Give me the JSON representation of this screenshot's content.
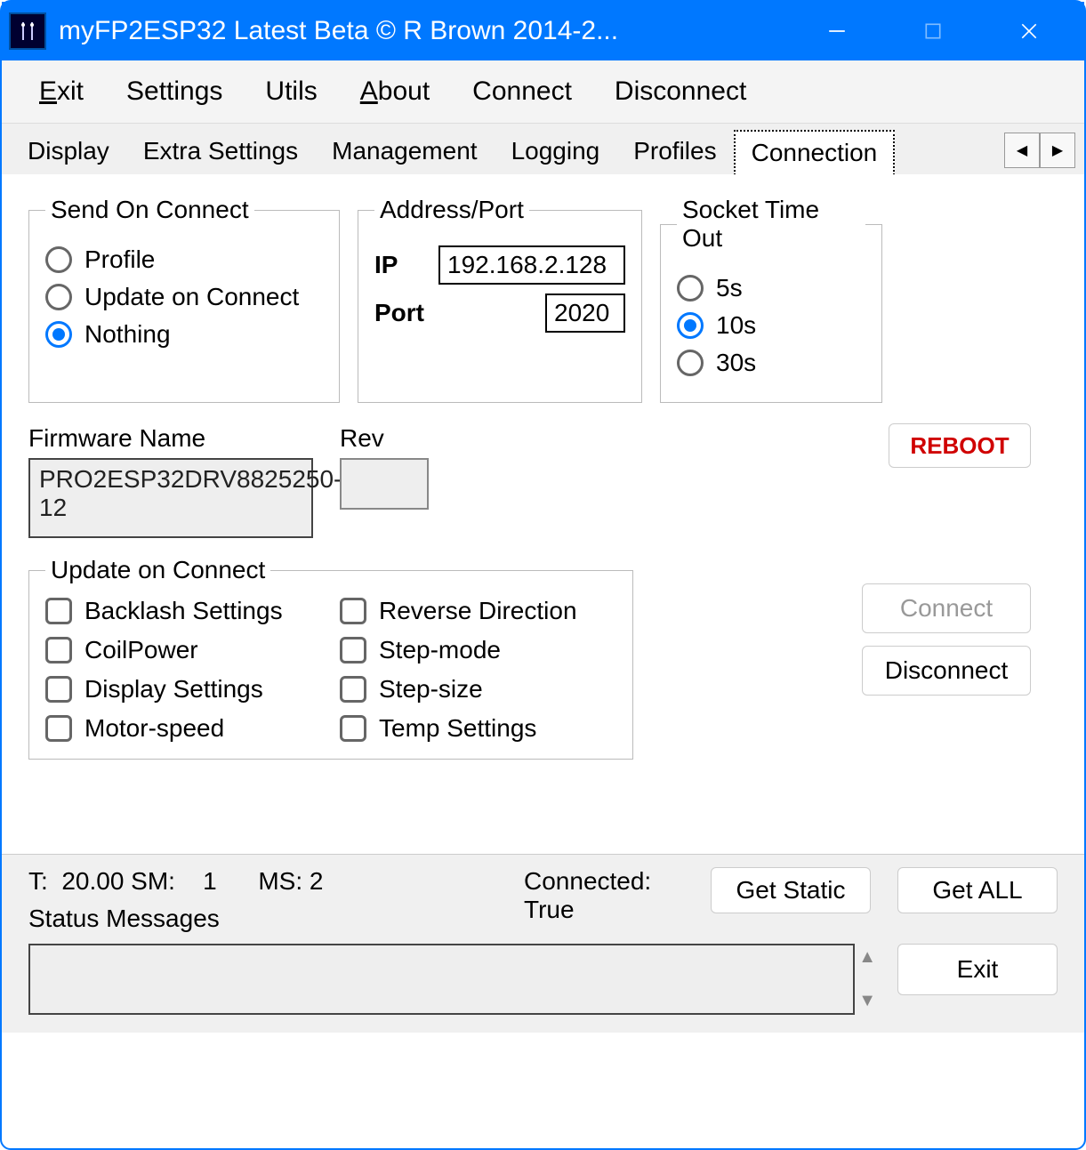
{
  "window": {
    "title": "myFP2ESP32 Latest Beta © R Brown 2014-2..."
  },
  "menu": {
    "exit": "Exit",
    "settings": "Settings",
    "utils": "Utils",
    "about": "About",
    "connect": "Connect",
    "disconnect": "Disconnect"
  },
  "tabs": {
    "display": "Display",
    "extra": "Extra Settings",
    "management": "Management",
    "logging": "Logging",
    "profiles": "Profiles",
    "connection": "Connection"
  },
  "sendOnConnect": {
    "legend": "Send On Connect",
    "profile": "Profile",
    "update": "Update on Connect",
    "nothing": "Nothing",
    "selected": "nothing"
  },
  "addressPort": {
    "legend": "Address/Port",
    "ipLabel": "IP",
    "ip": "192.168.2.128",
    "portLabel": "Port",
    "port": "2020"
  },
  "socketTimeout": {
    "legend": "Socket Time Out",
    "o5": "5s",
    "o10": "10s",
    "o30": "30s",
    "selected": "10s"
  },
  "firmware": {
    "label": "Firmware Name",
    "value": "PRO2ESP32DRV8825250-12",
    "revLabel": "Rev",
    "rev": ""
  },
  "reboot": {
    "label": "REBOOT"
  },
  "updateOnConnect": {
    "legend": "Update on Connect",
    "backlash": "Backlash Settings",
    "coilpower": "CoilPower",
    "displaysettings": "Display Settings",
    "motorspeed": "Motor-speed",
    "reversedir": "Reverse Direction",
    "stepmode": "Step-mode",
    "stepsize": "Step-size",
    "tempsettings": "Temp Settings"
  },
  "connBtns": {
    "connect": "Connect",
    "disconnect": "Disconnect"
  },
  "status": {
    "line1": "T:  20.00 SM:    1      MS: 2",
    "connectedLabel": "Connected:",
    "connectedValue": "True",
    "getStatic": "Get Static",
    "getAll": "Get ALL",
    "msgLabel": "Status Messages",
    "exit": "Exit"
  }
}
